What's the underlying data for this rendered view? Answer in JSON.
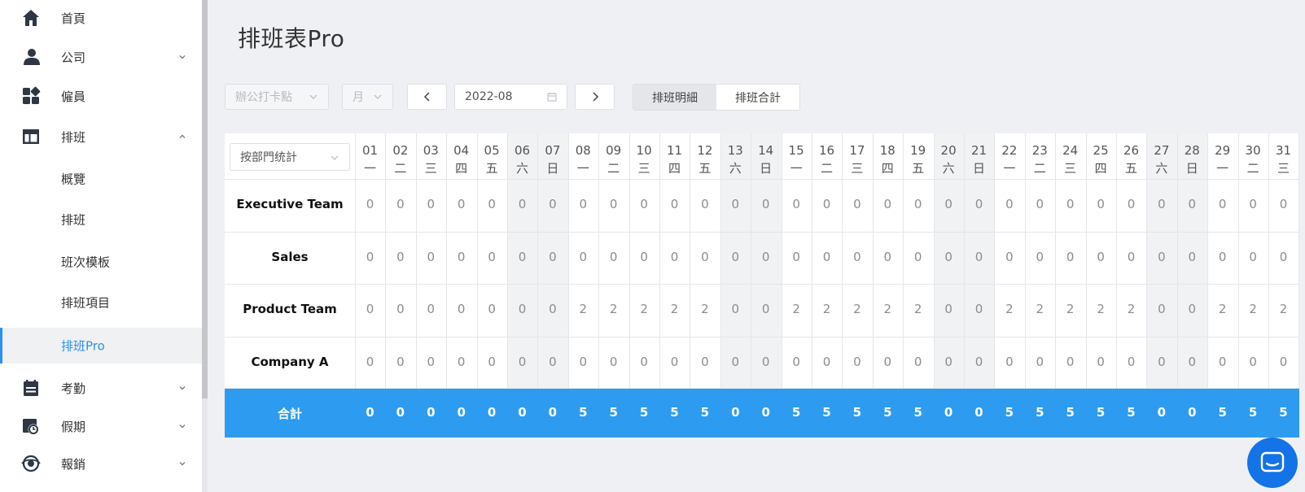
{
  "sidebar": {
    "items": [
      {
        "label": "首頁",
        "icon": "home-icon"
      },
      {
        "label": "公司",
        "icon": "person-icon"
      },
      {
        "label": "僱員",
        "icon": "apps-icon"
      },
      {
        "label": "排班",
        "icon": "layout-icon"
      },
      {
        "label": "考勤",
        "icon": "calendar-icon"
      },
      {
        "label": "假期",
        "icon": "clock-calendar-icon"
      },
      {
        "label": "報銷",
        "icon": "eye-icon"
      }
    ],
    "sub_items": [
      "概覽",
      "排班",
      "班次模板",
      "排班項目",
      "排班Pro"
    ],
    "active_sub": "排班Pro"
  },
  "page": {
    "title": "排班表Pro"
  },
  "toolbar": {
    "location_placeholder": "辦公打卡點",
    "period_value": "月",
    "prev_symbol": "<",
    "next_symbol": ">",
    "date_value": "2022-08",
    "view_tabs": [
      "排班明細",
      "排班合計"
    ],
    "active_view": "排班明細"
  },
  "table": {
    "group_by": "按部門统計",
    "days": [
      {
        "d": "01",
        "w": "一"
      },
      {
        "d": "02",
        "w": "二"
      },
      {
        "d": "03",
        "w": "三"
      },
      {
        "d": "04",
        "w": "四"
      },
      {
        "d": "05",
        "w": "五"
      },
      {
        "d": "06",
        "w": "六"
      },
      {
        "d": "07",
        "w": "日"
      },
      {
        "d": "08",
        "w": "一"
      },
      {
        "d": "09",
        "w": "二"
      },
      {
        "d": "10",
        "w": "三"
      },
      {
        "d": "11",
        "w": "四"
      },
      {
        "d": "12",
        "w": "五"
      },
      {
        "d": "13",
        "w": "六"
      },
      {
        "d": "14",
        "w": "日"
      },
      {
        "d": "15",
        "w": "一"
      },
      {
        "d": "16",
        "w": "二"
      },
      {
        "d": "17",
        "w": "三"
      },
      {
        "d": "18",
        "w": "四"
      },
      {
        "d": "19",
        "w": "五"
      },
      {
        "d": "20",
        "w": "六"
      },
      {
        "d": "21",
        "w": "日"
      },
      {
        "d": "22",
        "w": "一"
      },
      {
        "d": "23",
        "w": "二"
      },
      {
        "d": "24",
        "w": "三"
      },
      {
        "d": "25",
        "w": "四"
      },
      {
        "d": "26",
        "w": "五"
      },
      {
        "d": "27",
        "w": "六"
      },
      {
        "d": "28",
        "w": "日"
      },
      {
        "d": "29",
        "w": "一"
      },
      {
        "d": "30",
        "w": "二"
      },
      {
        "d": "31",
        "w": "三"
      }
    ],
    "weekend_days": [
      6,
      7,
      13,
      14,
      20,
      21,
      27,
      28
    ],
    "rows": [
      {
        "label": "Executive Team",
        "values": [
          0,
          0,
          0,
          0,
          0,
          0,
          0,
          0,
          0,
          0,
          0,
          0,
          0,
          0,
          0,
          0,
          0,
          0,
          0,
          0,
          0,
          0,
          0,
          0,
          0,
          0,
          0,
          0,
          0,
          0,
          0
        ]
      },
      {
        "label": "Sales",
        "values": [
          0,
          0,
          0,
          0,
          0,
          0,
          0,
          0,
          0,
          0,
          0,
          0,
          0,
          0,
          0,
          0,
          0,
          0,
          0,
          0,
          0,
          0,
          0,
          0,
          0,
          0,
          0,
          0,
          0,
          0,
          0
        ]
      },
      {
        "label": "Product Team",
        "values": [
          0,
          0,
          0,
          0,
          0,
          0,
          0,
          2,
          2,
          2,
          2,
          2,
          0,
          0,
          2,
          2,
          2,
          2,
          2,
          0,
          0,
          2,
          2,
          2,
          2,
          2,
          0,
          0,
          2,
          2,
          2
        ]
      },
      {
        "label": "Company A",
        "values": [
          0,
          0,
          0,
          0,
          0,
          0,
          0,
          0,
          0,
          0,
          0,
          0,
          0,
          0,
          0,
          0,
          0,
          0,
          0,
          0,
          0,
          0,
          0,
          0,
          0,
          0,
          0,
          0,
          0,
          0,
          0
        ]
      }
    ],
    "total": {
      "label": "合計",
      "values": [
        0,
        0,
        0,
        0,
        0,
        0,
        0,
        5,
        5,
        5,
        5,
        5,
        0,
        0,
        5,
        5,
        5,
        5,
        5,
        0,
        0,
        5,
        5,
        5,
        5,
        5,
        0,
        0,
        5,
        5,
        5
      ]
    }
  },
  "colors": {
    "accent": "#2d8ff0",
    "total_bg": "#2d9cf0",
    "chat": "#1473e6"
  }
}
